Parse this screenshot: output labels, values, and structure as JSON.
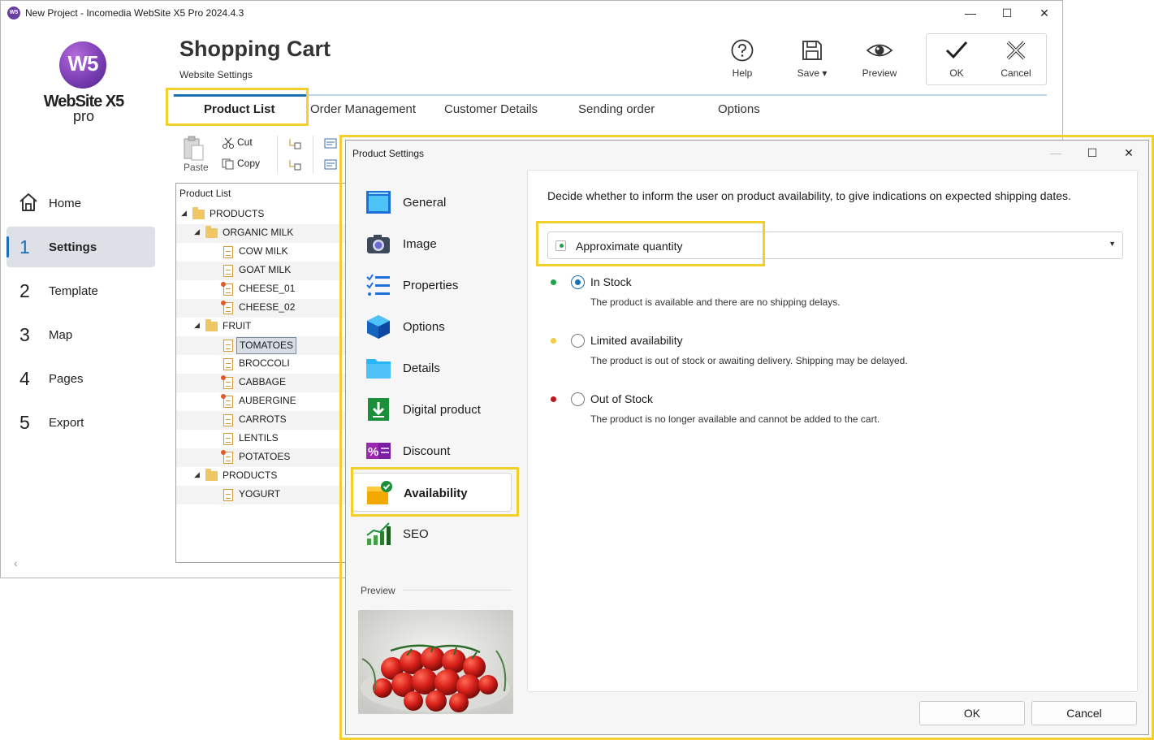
{
  "window": {
    "title": "New Project - Incomedia WebSite X5 Pro 2024.4.3",
    "app_icon_text": "W5",
    "controls": {
      "minimize": "—",
      "maximize": "☐",
      "close": "✕"
    }
  },
  "logo": {
    "mark": "W5",
    "name": "WebSite X5",
    "edition": "pro"
  },
  "nav": {
    "home": "Home",
    "items": [
      {
        "num": "1",
        "label": "Settings",
        "active": true
      },
      {
        "num": "2",
        "label": "Template"
      },
      {
        "num": "3",
        "label": "Map"
      },
      {
        "num": "4",
        "label": "Pages"
      },
      {
        "num": "5",
        "label": "Export"
      }
    ],
    "collapse": "‹"
  },
  "header": {
    "title": "Shopping Cart",
    "subtitle": "Website Settings"
  },
  "toolbar": {
    "help": "Help",
    "save": "Save ▾",
    "preview": "Preview",
    "ok": "OK",
    "cancel": "Cancel"
  },
  "tabs": [
    {
      "label": "Product List",
      "active": true
    },
    {
      "label": "Order Management"
    },
    {
      "label": "Customer Details"
    },
    {
      "label": "Sending order"
    },
    {
      "label": "Options"
    }
  ],
  "clipboard": {
    "paste": "Paste",
    "cut": "Cut",
    "copy": "Copy"
  },
  "tree": {
    "header": "Product List",
    "rows": [
      {
        "label": "PRODUCTS",
        "type": "folder",
        "level": 0,
        "expanded": true
      },
      {
        "label": "ORGANIC MILK",
        "type": "folder",
        "level": 1,
        "expanded": true
      },
      {
        "label": "COW MILK",
        "type": "doc",
        "level": 2
      },
      {
        "label": "GOAT MILK",
        "type": "doc",
        "level": 2
      },
      {
        "label": "CHEESE_01",
        "type": "doc-star",
        "level": 2
      },
      {
        "label": "CHEESE_02",
        "type": "doc-star",
        "level": 2
      },
      {
        "label": "FRUIT",
        "type": "folder",
        "level": 1,
        "expanded": true
      },
      {
        "label": "TOMATOES",
        "type": "doc",
        "level": 2,
        "selected": true
      },
      {
        "label": "BROCCOLI",
        "type": "doc",
        "level": 2
      },
      {
        "label": "CABBAGE",
        "type": "doc-star",
        "level": 2
      },
      {
        "label": "AUBERGINE",
        "type": "doc-star",
        "level": 2
      },
      {
        "label": "CARROTS",
        "type": "doc",
        "level": 2
      },
      {
        "label": "LENTILS",
        "type": "doc",
        "level": 2
      },
      {
        "label": "POTATOES",
        "type": "doc-star",
        "level": 2
      },
      {
        "label": "PRODUCTS",
        "type": "folder",
        "level": 1,
        "expanded": true
      },
      {
        "label": "YOGURT",
        "type": "doc",
        "level": 2
      }
    ]
  },
  "dialog": {
    "title": "Product Settings",
    "controls": {
      "minimize": "—",
      "maximize": "☐",
      "close": "✕"
    },
    "categories": [
      {
        "label": "General",
        "icon": "general-icon"
      },
      {
        "label": "Image",
        "icon": "camera-icon"
      },
      {
        "label": "Properties",
        "icon": "properties-list-icon"
      },
      {
        "label": "Options",
        "icon": "options-cube-icon"
      },
      {
        "label": "Details",
        "icon": "details-folder-icon"
      },
      {
        "label": "Digital product",
        "icon": "download-icon"
      },
      {
        "label": "Discount",
        "icon": "discount-percent-icon"
      },
      {
        "label": "Availability",
        "icon": "availability-box-check-icon",
        "selected": true
      },
      {
        "label": "SEO",
        "icon": "seo-chart-icon"
      }
    ],
    "preview_label": "Preview",
    "description": "Decide whether to inform the user on product availability, to give indications on expected shipping dates.",
    "availability_mode": {
      "selected": "Approximate quantity"
    },
    "options": [
      {
        "title": "In Stock",
        "desc": "The product is available and there are no shipping delays.",
        "color": "#1da34a",
        "checked": true
      },
      {
        "title": "Limited availability",
        "desc": "The product is out of stock or awaiting delivery. Shipping may be delayed.",
        "color": "#f3c94a",
        "checked": false
      },
      {
        "title": "Out of Stock",
        "desc": "The product is no longer available and cannot be added to the cart.",
        "color": "#c0161b",
        "checked": false
      }
    ],
    "ok": "OK",
    "cancel": "Cancel"
  },
  "colors": {
    "accent": "#1b6fb3",
    "highlight": "#f4cf2b",
    "brand_purple": "#7b3fb5"
  }
}
